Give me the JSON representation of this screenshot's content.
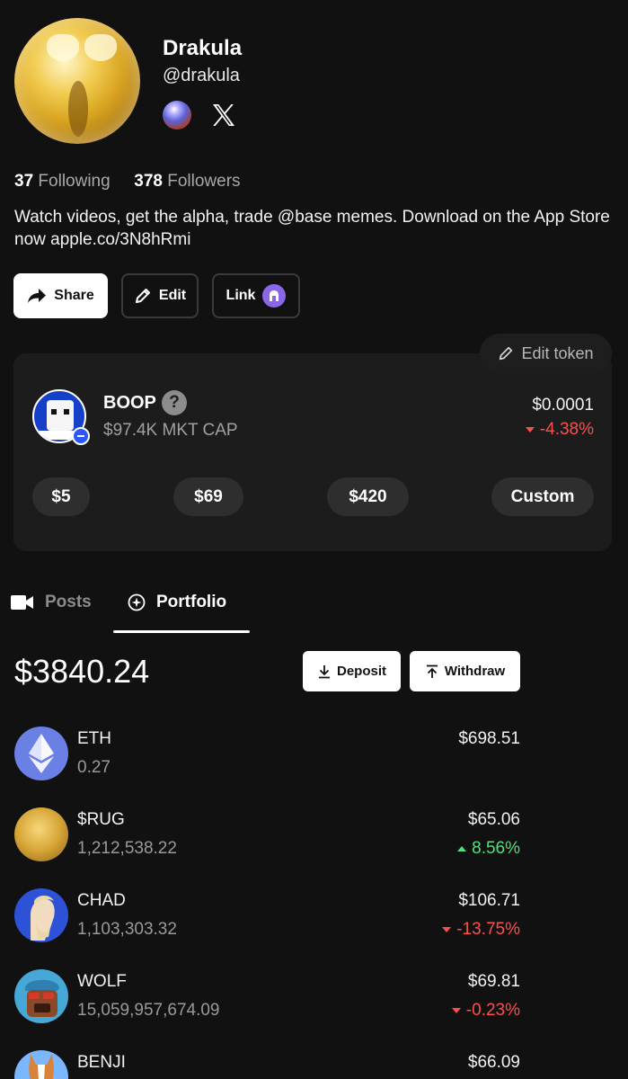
{
  "profile": {
    "name": "Drakula",
    "handle": "@drakula",
    "following_count": "37",
    "following_label": "Following",
    "followers_count": "378",
    "followers_label": "Followers",
    "bio": "Watch videos, get the alpha, trade @base memes. Download on the App Store now apple.co/3N8hRmi",
    "icons": [
      "orb-icon",
      "x-logo-icon"
    ]
  },
  "actions": {
    "share_label": "Share",
    "edit_label": "Edit",
    "link_label": "Link"
  },
  "token": {
    "edit_label": "Edit token",
    "name": "BOOP",
    "help_glyph": "?",
    "market_cap": "$97.4K MKT CAP",
    "price": "$0.0001",
    "change": "-4.38%",
    "amounts": [
      "$5",
      "$69",
      "$420",
      "Custom"
    ]
  },
  "tabs": {
    "posts": "Posts",
    "portfolio": "Portfolio",
    "active": "portfolio"
  },
  "portfolio": {
    "total": "$3840.24",
    "deposit_label": "Deposit",
    "withdraw_label": "Withdraw",
    "holdings": [
      {
        "symbol": "ETH",
        "quantity": "0.27",
        "value": "$698.51",
        "change": ""
      },
      {
        "symbol": "$RUG",
        "quantity": "1,212,538.22",
        "value": "$65.06",
        "change": "8.56%"
      },
      {
        "symbol": "CHAD",
        "quantity": "1,103,303.32",
        "value": "$106.71",
        "change": "-13.75%"
      },
      {
        "symbol": "WOLF",
        "quantity": "15,059,957,674.09",
        "value": "$69.81",
        "change": "-0.23%"
      },
      {
        "symbol": "BENJI",
        "quantity": "",
        "value": "$66.09",
        "change": ""
      }
    ]
  },
  "colors": {
    "background": "#111111",
    "card": "#1c1c1c",
    "negative": "#ff4d4d",
    "positive": "#4ee07a",
    "link_badge": "#8a66e8"
  }
}
